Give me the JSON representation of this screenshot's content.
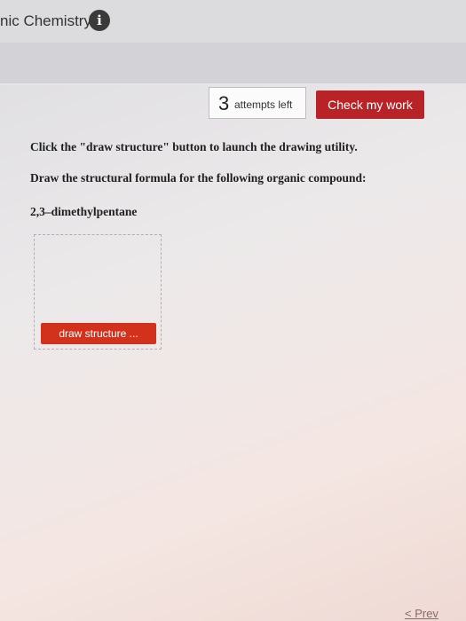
{
  "header": {
    "course_title": "nic Chemistry",
    "info_icon": "i"
  },
  "attempts": {
    "count": "3",
    "label": "attempts left"
  },
  "check_button_label": "Check my work",
  "instructions": {
    "line1": "Click the \"draw structure\" button to launch the drawing utility.",
    "line2": "Draw the structural formula for the following organic compound:",
    "compound": "2,3–dimethylpentane"
  },
  "draw_button_label": "draw structure ...",
  "nav": {
    "prev_label": "< Prev"
  }
}
